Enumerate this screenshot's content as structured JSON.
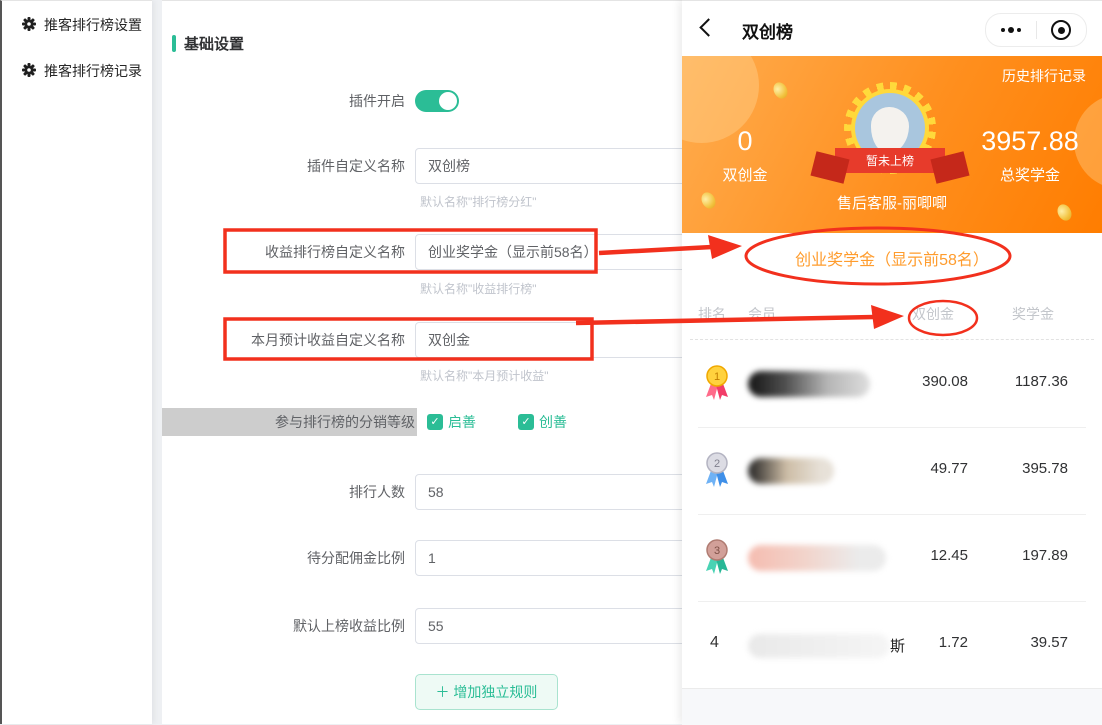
{
  "sidebar": {
    "items": [
      {
        "label": "推客排行榜设置"
      },
      {
        "label": "推客排行榜记录"
      }
    ]
  },
  "form": {
    "section_title": "基础设置",
    "plugin_toggle": {
      "label": "插件开启",
      "on": true
    },
    "plugin_name": {
      "label": "插件自定义名称",
      "value": "双创榜",
      "hint": "默认名称\"排行榜分红\""
    },
    "rank_name": {
      "label": "收益排行榜自定义名称",
      "value": "创业奖学金（显示前58名）",
      "hint": "默认名称\"收益排行榜\""
    },
    "month_income_name": {
      "label": "本月预计收益自定义名称",
      "value": "双创金",
      "hint": "默认名称\"本月预计收益\""
    },
    "levels": {
      "label": "参与排行榜的分销等级",
      "options": [
        {
          "label": "启善",
          "checked": true,
          "check_glyph": "✓"
        },
        {
          "label": "创善",
          "checked": true,
          "check_glyph": "✓"
        }
      ]
    },
    "rank_count": {
      "label": "排行人数",
      "value": "58"
    },
    "commission_ratio": {
      "label": "待分配佣金比例",
      "value": "1"
    },
    "default_ratio": {
      "label": "默认上榜收益比例",
      "value": "55"
    },
    "add_rule_button": "＋ 增加独立规则"
  },
  "phone": {
    "title": "双创榜",
    "banner": {
      "history_link": "历史排行记录",
      "left_value": "0",
      "left_label": "双创金",
      "right_value": "3957.88",
      "right_label": "总奖学金",
      "badge_text": "暂未上榜",
      "user_name": "售后客服-丽唧唧"
    },
    "subtitle": "创业奖学金（显示前58名）",
    "table": {
      "headers": [
        "排名",
        "会员",
        "双创金",
        "奖学金"
      ],
      "rows": [
        {
          "rank": "1",
          "medal": "gold-medal",
          "shuangchuang": "390.08",
          "scholarship": "1187.36",
          "name_suffix": ""
        },
        {
          "rank": "2",
          "medal": "silver-medal",
          "shuangchuang": "49.77",
          "scholarship": "395.78",
          "name_suffix": ""
        },
        {
          "rank": "3",
          "medal": "bronze-medal",
          "shuangchuang": "12.45",
          "scholarship": "197.89",
          "name_suffix": ""
        },
        {
          "rank": "4",
          "medal": "none",
          "shuangchuang": "1.72",
          "scholarship": "39.57",
          "name_suffix": "斯"
        }
      ]
    }
  },
  "colors": {
    "accent_teal": "#2bbd96",
    "banner_orange_start": "#ffad4f",
    "banner_orange_end": "#ff7d00",
    "annotation_red": "#f2301d",
    "subtitle_orange": "#ff9c2d"
  }
}
